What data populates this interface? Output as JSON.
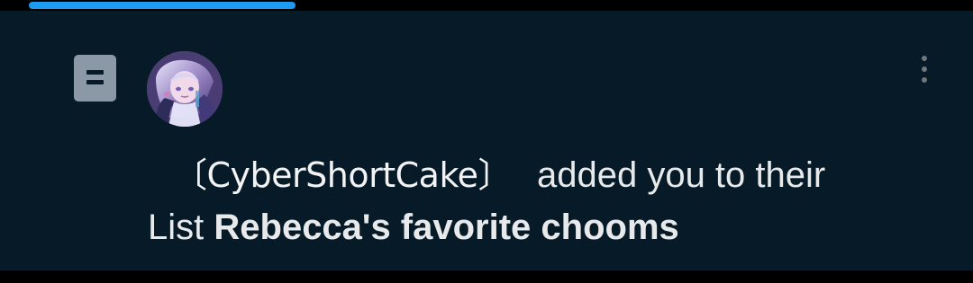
{
  "notification": {
    "username": "〔CyberShortCake〕",
    "action_text": "added you to their",
    "list_prefix": "List",
    "list_name": "Rebecca's favorite chooms"
  },
  "icons": {
    "type_icon": "list-icon",
    "more_icon": "more-vertical-icon",
    "avatar": "user-avatar-image"
  },
  "colors": {
    "background": "#061a27",
    "text": "#e7e9ea",
    "accent": "#1d9bf0",
    "secondary": "#71767b"
  }
}
